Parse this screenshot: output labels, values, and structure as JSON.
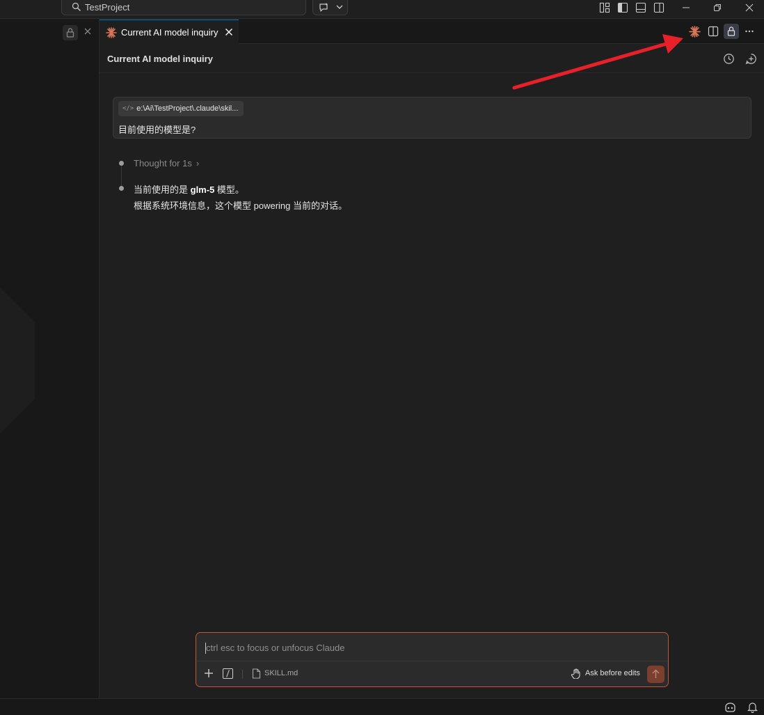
{
  "titlebar": {
    "search_text": "TestProject",
    "icons": [
      "search-icon",
      "chat-icon",
      "chevron-down-icon",
      "customize-layout-icon",
      "toggle-primary-sidebar-icon",
      "toggle-panel-icon",
      "toggle-secondary-sidebar-icon",
      "minimize-icon",
      "restore-icon",
      "close-icon"
    ]
  },
  "tab": {
    "label": "Current AI model inquiry",
    "icon": "claude-spark-icon"
  },
  "header": {
    "title": "Current AI model inquiry",
    "icons": [
      "history-icon",
      "new-chat-icon"
    ]
  },
  "conversation": {
    "user_message": {
      "attachment": "e:\\Ai\\TestProject\\.claude\\skil...",
      "text": "目前使用的模型是?"
    },
    "thought": "Thought for 1s",
    "answer_line1_prefix": "当前使用的是 ",
    "answer_model": "glm-5",
    "answer_line1_suffix": " 模型。",
    "answer_line2": "根据系统环境信息，这个模型 powering 当前的对话。"
  },
  "input": {
    "placeholder": "ctrl esc to focus or unfocus Claude",
    "file": "SKILL.md",
    "mode": "Ask before edits"
  },
  "colors": {
    "accent": "#d97757",
    "input_border": "#c2553a",
    "annotation_arrow": "#e8202a",
    "tab_active_border": "#0078d4"
  }
}
